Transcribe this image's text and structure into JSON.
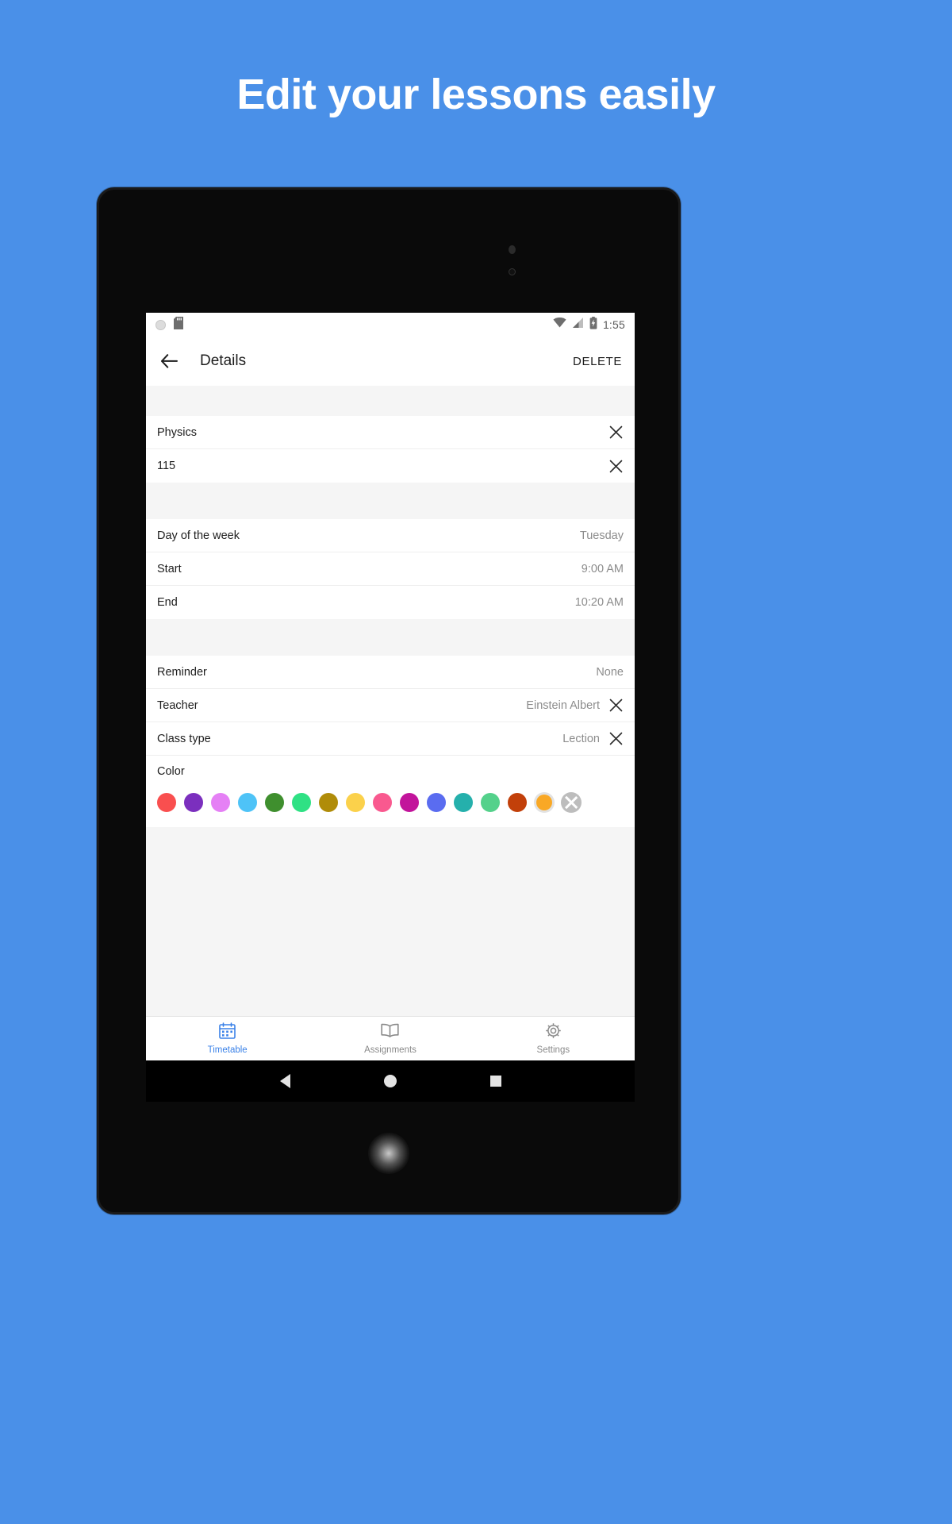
{
  "promo": {
    "headline": "Edit your lessons easily",
    "background_color": "#4a90e8"
  },
  "status_bar": {
    "time": "1:55",
    "icons": [
      "circle-icon",
      "sdcard-icon",
      "wifi-icon",
      "signal-icon",
      "battery-charging-icon"
    ]
  },
  "toolbar": {
    "back_label": "back-arrow-icon",
    "title": "Details",
    "delete_label": "DELETE"
  },
  "form": {
    "section1": [
      {
        "name": "subject",
        "value": "Physics",
        "clearable": true
      },
      {
        "name": "room",
        "value": "115",
        "clearable": true
      }
    ],
    "section2": [
      {
        "name": "day-of-the-week",
        "label": "Day of the week",
        "value": "Tuesday",
        "clearable": false
      },
      {
        "name": "start",
        "label": "Start",
        "value": "9:00 AM",
        "clearable": false
      },
      {
        "name": "end",
        "label": "End",
        "value": "10:20 AM",
        "clearable": false
      }
    ],
    "section3": [
      {
        "name": "reminder",
        "label": "Reminder",
        "value": "None",
        "clearable": false
      },
      {
        "name": "teacher",
        "label": "Teacher",
        "value": "Einstein Albert",
        "clearable": true
      },
      {
        "name": "class-type",
        "label": "Class type",
        "value": "Lection",
        "clearable": true
      }
    ],
    "color": {
      "label": "Color",
      "selected_index": 14,
      "swatches": [
        "#f94f4f",
        "#7b2fbe",
        "#e580f5",
        "#4ec3f7",
        "#3f8f2e",
        "#2fe184",
        "#b08c09",
        "#fbd14b",
        "#f9598f",
        "#c2149b",
        "#5a6cf0",
        "#25b0ac",
        "#54d18b",
        "#c2400a",
        "#f9a825"
      ],
      "none_option": "no-color-option"
    }
  },
  "bottom_nav": {
    "items": [
      {
        "name": "timetable",
        "label": "Timetable",
        "icon": "calendar-icon",
        "active": true
      },
      {
        "name": "assignments",
        "label": "Assignments",
        "icon": "book-icon",
        "active": false
      },
      {
        "name": "settings",
        "label": "Settings",
        "icon": "gear-icon",
        "active": false
      }
    ],
    "active_color": "#3b82e8",
    "inactive_color": "#8a8a8a"
  },
  "android_nav": {
    "buttons": [
      "back-nav-button",
      "home-nav-button",
      "recents-nav-button"
    ]
  }
}
